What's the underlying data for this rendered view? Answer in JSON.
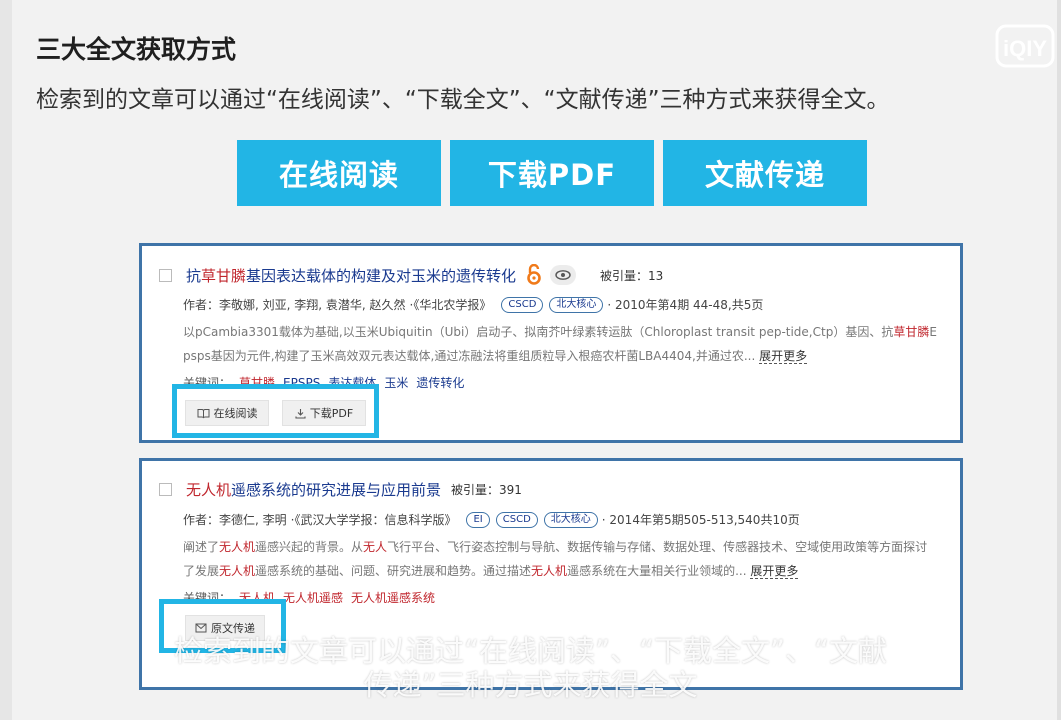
{
  "heading": "三大全文获取方式",
  "intro": "检索到的文章可以通过“在线阅读”、“下载全文”、“文献传递”三种方式来获得全文。",
  "logo": {
    "text": "iQIY",
    "icon": "iqiyi-logo"
  },
  "big_buttons": [
    "在线阅读",
    "下载PDF",
    "文献传递"
  ],
  "articles": [
    {
      "title_pre": "抗",
      "title_hl": "草甘膦",
      "title_post": "基因表达载体的构建及对玉米的遗传转化",
      "citation": "被引量：13",
      "meta": {
        "label": "作者：",
        "authors": "李敬娜, 刘亚, 李翔, 袁潜华, 赵久然",
        "journal": "·《华北农学报》",
        "badges": [
          "CSCD",
          "北大核心"
        ],
        "date": "· 2010年第4期 44-48,共5页"
      },
      "abstract_line1_a": "以pCambia3301载体为基础,以玉米Ubiquitin（Ubi）启动子、拟南芥叶绿素转运肽（Chloroplast transit pep-tide,Ctp）基因、抗",
      "abstract_line1_hl": "草甘膦",
      "abstract_line1_b": "E",
      "abstract_line2": "psps基因为元件,构建了玉米高效双元表达载体,通过冻融法将重组质粒导入根癌农杆菌LBA4404,并通过农... ",
      "more": "展开更多",
      "keywords_label": "关键词：",
      "keywords": [
        {
          "text": "草甘膦",
          "hl": true
        },
        {
          "text": "EPSPS",
          "hl": false
        },
        {
          "text": "表达载体",
          "hl": false
        },
        {
          "text": "玉米",
          "hl": false
        },
        {
          "text": "遗传转化",
          "hl": false
        }
      ],
      "actions": [
        "在线阅读",
        "下载PDF"
      ]
    },
    {
      "title_hl": "无人机",
      "title_post": "遥感系统的研究进展与应用前景",
      "citation": "被引量：391",
      "meta": {
        "label": "作者：",
        "authors": "李德仁, 李明",
        "journal": "·《武汉大学学报：信息科学版》",
        "badges": [
          "EI",
          "CSCD",
          "北大核心"
        ],
        "date": "· 2014年第5期505-513,540共10页"
      },
      "abstract_line1_a": "阐述了",
      "abstract_line1_hl": "无人机",
      "abstract_line1_b": "遥感兴起的背景。从",
      "abstract_line1_hl2": "无人",
      "abstract_line1_c": "飞行平台、飞行姿态控制与导航、数据传输与存储、数据处理、传感器技术、空域使用政策等方面探讨",
      "abstract_line2_a": "了发展",
      "abstract_line2_hl": "无人机",
      "abstract_line2_b": "遥感系统的基础、问题、研究进展和趋势。通过描述",
      "abstract_line2_hl2": "无人机",
      "abstract_line2_c": "遥感系统在大量相关行业领域的... ",
      "more": "展开更多",
      "keywords_label": "关键词：",
      "keywords": [
        {
          "text": "无人机",
          "hl": true
        },
        {
          "text": "无人机遥感",
          "hl": true
        },
        {
          "text": "无人机遥感系统",
          "hl": true
        }
      ],
      "actions": [
        "原文传递"
      ]
    }
  ],
  "subtitle_line1": "检索到的文章可以通过“在线阅读”、“下载全文”、“文献",
  "subtitle_line2": "传递”三种方式来获得全文",
  "colors": {
    "accent": "#22b5e5",
    "card_border": "#3f74a8",
    "highlight": "#c0262d",
    "link": "#1a3a8f"
  }
}
